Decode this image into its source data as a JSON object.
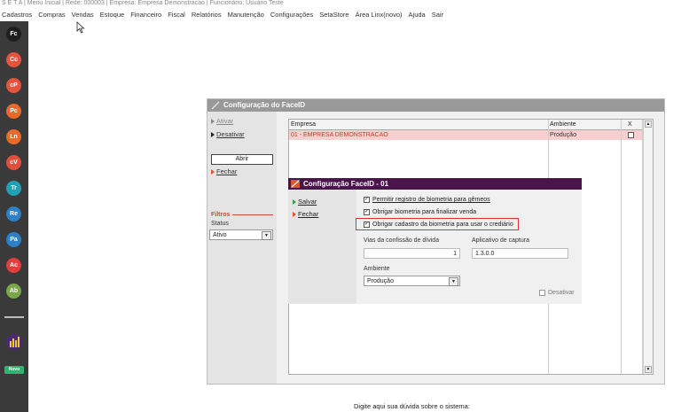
{
  "title_bar": "S E T A | Menu Inicial | Rede: 000003 | Empresa: Empresa Demonstracao | Funcionário: Usuário Teste",
  "menu": [
    "Cadastros",
    "Compras",
    "Vendas",
    "Estoque",
    "Financeiro",
    "Fiscal",
    "Relatórios",
    "Manutenção",
    "Configurações",
    "SetaStore",
    "Área Linx(novo)",
    "Ajuda",
    "Sair"
  ],
  "sidebar": {
    "icons": [
      {
        "label": "Fc",
        "color": "#1e1e1e",
        "icon": "fc-icon"
      },
      {
        "label": "Cc",
        "color": "#e5533d",
        "icon": "cc-icon"
      },
      {
        "label": "cP",
        "color": "#e5533d",
        "icon": "cp-icon"
      },
      {
        "label": "Pc",
        "color": "#e8692a",
        "icon": "pc-icon"
      },
      {
        "label": "Ln",
        "color": "#e8692a",
        "icon": "ln-icon"
      },
      {
        "label": "cV",
        "color": "#e04f3b",
        "icon": "cv-icon"
      },
      {
        "label": "Tr",
        "color": "#21a0b5",
        "icon": "tr-icon"
      },
      {
        "label": "Re",
        "color": "#2d80c5",
        "icon": "re-icon"
      },
      {
        "label": "Pa",
        "color": "#2d80c5",
        "icon": "pa-icon"
      },
      {
        "label": "Ac",
        "color": "#e33d3d",
        "icon": "ac-icon"
      },
      {
        "label": "Ab",
        "color": "#78a84a",
        "icon": "ab-icon"
      }
    ],
    "new_badge": "Novo"
  },
  "dialog": {
    "title": "Configuração do FaceID",
    "actions": {
      "ativar": "Ativar",
      "desativar": "Desativar",
      "abrir": "Abrir",
      "fechar": "Fechar"
    },
    "filters": {
      "label": "Filtros",
      "status_label": "Status",
      "status_value": "Ativo"
    },
    "grid": {
      "headers": [
        "Empresa",
        "Ambiente",
        "X"
      ],
      "rows": [
        {
          "empresa": "01 - EMPRESA DEMONSTRACAO",
          "ambiente": "Produção",
          "x": false
        }
      ]
    }
  },
  "inner_dialog": {
    "title": "Configuração FaceID - 01",
    "actions": {
      "salvar": "Salvar",
      "fechar": "Fechar"
    },
    "options": [
      {
        "label": "Permitir registro de biometria para gêmeos",
        "checked": true
      },
      {
        "label": "Obrigar biometria para finalizar venda",
        "checked": true
      },
      {
        "label": "Obrigar cadastro da biometria para usar o crediário",
        "checked": true
      }
    ],
    "vias": {
      "label": "Vias da confissão de dívida",
      "value": "1"
    },
    "aplicativo": {
      "label": "Aplicativo de captura",
      "value": "1.3.0.0"
    },
    "ambiente": {
      "label": "Ambiente",
      "value": "Produção"
    },
    "desativar": {
      "label": "Desativar",
      "checked": false
    }
  },
  "help_prompt": "Digite aqui sua dúvida sobre o sistema:"
}
